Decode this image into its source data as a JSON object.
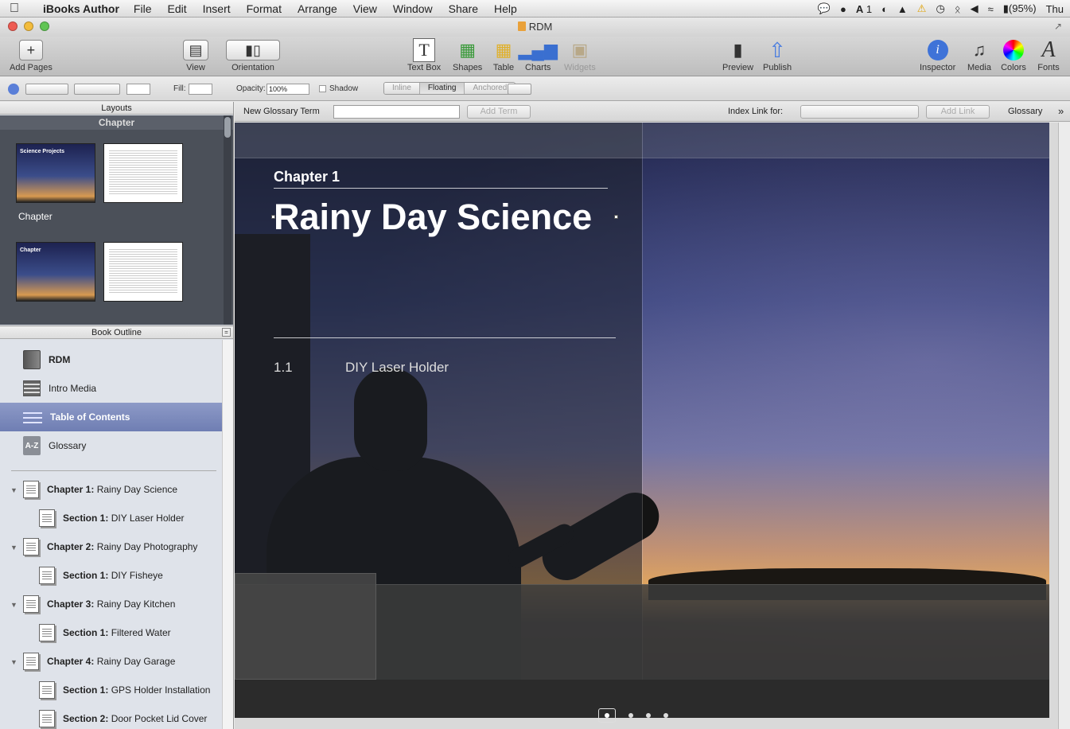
{
  "menubar": {
    "app_name": "iBooks Author",
    "menus": [
      "File",
      "Edit",
      "Insert",
      "Format",
      "Arrange",
      "View",
      "Window",
      "Share",
      "Help"
    ],
    "status": {
      "count": "1",
      "battery": "(95%)",
      "clock": "Thu"
    }
  },
  "window": {
    "title": "RDM"
  },
  "toolbar": {
    "add_pages": "Add Pages",
    "view": "View",
    "orientation": "Orientation",
    "text_box": "Text Box",
    "shapes": "Shapes",
    "table": "Table",
    "charts": "Charts",
    "widgets": "Widgets",
    "preview": "Preview",
    "publish": "Publish",
    "inspector": "Inspector",
    "media": "Media",
    "colors": "Colors",
    "fonts": "Fonts"
  },
  "formatbar": {
    "fill_label": "Fill:",
    "opacity_label": "Opacity:",
    "opacity_value": "100%",
    "shadow_label": "Shadow",
    "wrap_options": [
      "Inline",
      "Floating",
      "Anchored"
    ],
    "wrap_selected": "Floating"
  },
  "glossarybar": {
    "new_term_label": "New Glossary Term",
    "new_term_value": "",
    "add_term": "Add Term",
    "index_link_label": "Index Link for:",
    "add_link": "Add Link",
    "glossary": "Glossary"
  },
  "sidebar": {
    "layouts_header": "Layouts",
    "layouts_section": "Chapter",
    "thumb_label": "Chapter",
    "thumb1_title": "Science Projects",
    "thumb3_title": "Chapter",
    "outline_header": "Book Outline",
    "top_items": [
      {
        "label": "RDM"
      },
      {
        "label": "Intro Media"
      },
      {
        "label": "Table of Contents"
      },
      {
        "label": "Glossary"
      }
    ],
    "az_icon_text": "A-Z",
    "chapters": [
      {
        "prefix": "Chapter 1:",
        "name": "Rainy Day Science",
        "section_prefix": "Section 1:",
        "section": "DIY Laser Holder"
      },
      {
        "prefix": "Chapter 2:",
        "name": "Rainy Day Photography",
        "section_prefix": "Section 1:",
        "section": "DIY Fisheye"
      },
      {
        "prefix": "Chapter 3:",
        "name": "Rainy Day Kitchen",
        "section_prefix": "Section 1:",
        "section": "Filtered Water"
      },
      {
        "prefix": "Chapter 4:",
        "name": "Rainy Day Garage",
        "section_prefix": "Section 1:",
        "section": "GPS Holder Installation"
      }
    ],
    "extra_section": {
      "prefix": "Section 2:",
      "name": "Door Pocket Lid Cover"
    }
  },
  "page": {
    "chapter_label": "Chapter 1",
    "title": "Rainy Day Science",
    "toc_number": "1.1",
    "toc_title": "DIY Laser Holder"
  }
}
